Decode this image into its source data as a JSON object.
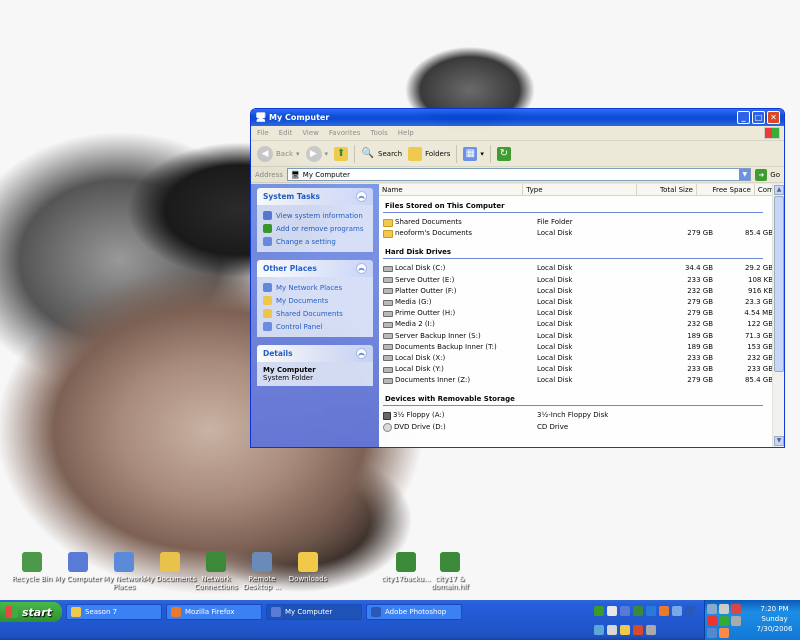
{
  "desktop": {
    "icons": [
      {
        "label": "Recycle Bin",
        "color": "#4a9a4a"
      },
      {
        "label": "My Computer",
        "color": "#5a7ad8"
      },
      {
        "label": "My Network Places",
        "color": "#5a8ad8"
      },
      {
        "label": "My Documents",
        "color": "#e8c24a"
      },
      {
        "label": "Network Connections",
        "color": "#3a8a3a"
      },
      {
        "label": "Remote Desktop ...",
        "color": "#6a8ab8"
      },
      {
        "label": "Downloads",
        "color": "#f0c84a"
      },
      {
        "label": "city17backu...",
        "color": "#3a8a3a"
      },
      {
        "label": "city17 & domain.hlf",
        "color": "#3a8a3a"
      }
    ]
  },
  "window": {
    "title": "My Computer",
    "menu": [
      "File",
      "Edit",
      "View",
      "Favorites",
      "Tools",
      "Help"
    ],
    "toolbar": {
      "back": "Back",
      "search": "Search",
      "folders": "Folders"
    },
    "address": {
      "label": "Address",
      "value": "My Computer",
      "go": "Go"
    },
    "taskpane": {
      "system_tasks": {
        "title": "System Tasks",
        "items": [
          "View system information",
          "Add or remove programs",
          "Change a setting"
        ]
      },
      "other_places": {
        "title": "Other Places",
        "items": [
          "My Network Places",
          "My Documents",
          "Shared Documents",
          "Control Panel"
        ]
      },
      "details": {
        "title": "Details",
        "name": "My Computer",
        "desc": "System Folder"
      }
    },
    "columns": [
      "Name",
      "Type",
      "Total Size",
      "Free Space",
      "Comme"
    ],
    "groups": [
      {
        "title": "Files Stored on This Computer",
        "items": [
          {
            "name": "Shared Documents",
            "type": "File Folder",
            "total": "",
            "free": "",
            "icon": "folder"
          },
          {
            "name": "neoform's Documents",
            "type": "Local Disk",
            "total": "279 GB",
            "free": "85.4 GB",
            "icon": "folder"
          }
        ]
      },
      {
        "title": "Hard Disk Drives",
        "items": [
          {
            "name": "Local Disk (C:)",
            "type": "Local Disk",
            "total": "34.4 GB",
            "free": "29.2 GB",
            "icon": "disk"
          },
          {
            "name": "Serve Outter (E:)",
            "type": "Local Disk",
            "total": "233 GB",
            "free": "108 KB",
            "icon": "disk"
          },
          {
            "name": "Platter Outter (F:)",
            "type": "Local Disk",
            "total": "232 GB",
            "free": "916 KB",
            "icon": "disk"
          },
          {
            "name": "Media (G:)",
            "type": "Local Disk",
            "total": "279 GB",
            "free": "23.3 GB",
            "icon": "disk"
          },
          {
            "name": "Prime Outter (H:)",
            "type": "Local Disk",
            "total": "279 GB",
            "free": "4.54 MB",
            "icon": "disk"
          },
          {
            "name": "Media 2 (I:)",
            "type": "Local Disk",
            "total": "232 GB",
            "free": "122 GB",
            "icon": "disk"
          },
          {
            "name": "Server Backup Inner (S:)",
            "type": "Local Disk",
            "total": "189 GB",
            "free": "71.3 GB",
            "icon": "disk"
          },
          {
            "name": "Documents Backup Inner (T:)",
            "type": "Local Disk",
            "total": "189 GB",
            "free": "153 GB",
            "icon": "disk"
          },
          {
            "name": "Local Disk (X:)",
            "type": "Local Disk",
            "total": "233 GB",
            "free": "232 GB",
            "icon": "disk"
          },
          {
            "name": "Local Disk (Y:)",
            "type": "Local Disk",
            "total": "233 GB",
            "free": "233 GB",
            "icon": "disk"
          },
          {
            "name": "Documents Inner (Z:)",
            "type": "Local Disk",
            "total": "279 GB",
            "free": "85.4 GB",
            "icon": "disk"
          }
        ]
      },
      {
        "title": "Devices with Removable Storage",
        "items": [
          {
            "name": "3½ Floppy (A:)",
            "type": "3½-Inch Floppy Disk",
            "total": "",
            "free": "",
            "icon": "floppy"
          },
          {
            "name": "DVD Drive (D:)",
            "type": "CD Drive",
            "total": "",
            "free": "",
            "icon": "cdrom"
          }
        ]
      }
    ]
  },
  "taskbar": {
    "start": "start",
    "tasks": [
      {
        "label": "Season 7",
        "color": "#f0c84a",
        "active": false
      },
      {
        "label": "Mozilla Firefox",
        "color": "#e87a2a",
        "active": false
      },
      {
        "label": "My Computer",
        "color": "#5a7ad8",
        "active": true
      },
      {
        "label": "Adobe Photoshop",
        "color": "#2a5ab8",
        "active": false
      }
    ],
    "clock": {
      "time": "7:20 PM",
      "day": "Sunday",
      "date": "7/30/2006"
    }
  }
}
